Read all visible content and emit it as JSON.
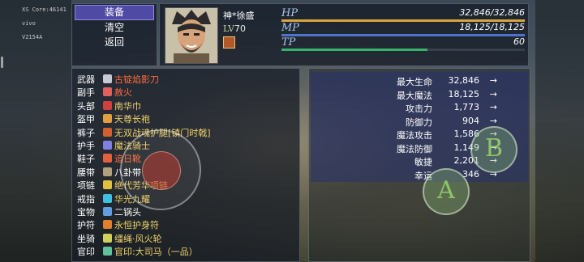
{
  "system": {
    "lines": [
      "XS Core:46141",
      "vivo",
      "V2154A"
    ]
  },
  "menu": {
    "items": [
      {
        "label": "装备",
        "active": true
      },
      {
        "label": "清空",
        "active": false
      },
      {
        "label": "返回",
        "active": false
      }
    ]
  },
  "character": {
    "name": "神*徐盛",
    "lv_prefix": "LV",
    "level": "70",
    "stats": [
      {
        "label": "HP",
        "value": "32,846/32,846",
        "fill": 1.0,
        "color": "#d9a43c"
      },
      {
        "label": "MP",
        "value": "18,125/18,125",
        "fill": 1.0,
        "color": "#4f73c9"
      },
      {
        "label": "TP",
        "value": "60",
        "fill": 0.6,
        "color": "#36b36a"
      }
    ]
  },
  "equipment": [
    {
      "slot": "武器",
      "item": "古锭焰影刀",
      "color": "#ff6b3d",
      "icon": "sword-icon",
      "icon_color": "#c9c9d6"
    },
    {
      "slot": "副手",
      "item": "赦火",
      "color": "#ff6b3d",
      "icon": "dagger-icon",
      "icon_color": "#e06060"
    },
    {
      "slot": "头部",
      "item": "南华巾",
      "color": "#f0d36a",
      "icon": "hat-icon",
      "icon_color": "#d04040"
    },
    {
      "slot": "盔甲",
      "item": "天尊长袍",
      "color": "#f0d36a",
      "icon": "armor-icon",
      "icon_color": "#e0a040"
    },
    {
      "slot": "裤子",
      "item": "无双战魂护腿[镇门时戟]",
      "color": "#f0d36a",
      "icon": "greaves-icon",
      "icon_color": "#d06030"
    },
    {
      "slot": "护手",
      "item": "魔法骑士",
      "color": "#f0d36a",
      "icon": "gauntlet-icon",
      "icon_color": "#8080e0"
    },
    {
      "slot": "鞋子",
      "item": "追日靴",
      "color": "#ff6b3d",
      "icon": "boots-icon",
      "icon_color": "#e06040"
    },
    {
      "slot": "腰带",
      "item": "八卦带",
      "color": "#ffffff",
      "icon": "belt-icon",
      "icon_color": "#b0a080"
    },
    {
      "slot": "项链",
      "item": "绝代芳华项链",
      "color": "#f0d36a",
      "icon": "necklace-icon",
      "icon_color": "#e0c040"
    },
    {
      "slot": "戒指",
      "item": "华光九耀",
      "color": "#f0d36a",
      "icon": "ring-icon",
      "icon_color": "#40c0e0"
    },
    {
      "slot": "宝物",
      "item": "二锅头",
      "color": "#ffffff",
      "icon": "bottle-icon",
      "icon_color": "#60a0e0"
    },
    {
      "slot": "护符",
      "item": "永恒护身符",
      "color": "#f0d36a",
      "icon": "amulet-icon",
      "icon_color": "#e08030"
    },
    {
      "slot": "坐骑",
      "item": "缰绳·风火轮",
      "color": "#f0d36a",
      "icon": "reins-icon",
      "icon_color": "#d0d060"
    },
    {
      "slot": "官印",
      "item": "官印:大司马（一品）",
      "color": "#f0d36a",
      "icon": "seal-icon",
      "icon_color": "#60c0a0"
    }
  ],
  "attributes": [
    {
      "label": "最大生命",
      "value": "32,846",
      "arrow": "→"
    },
    {
      "label": "最大魔法",
      "value": "18,125",
      "arrow": "→"
    },
    {
      "label": "攻击力",
      "value": "1,773",
      "arrow": "→"
    },
    {
      "label": "防御力",
      "value": "904",
      "arrow": "→"
    },
    {
      "label": "魔法攻击",
      "value": "1,586",
      "arrow": "→"
    },
    {
      "label": "魔法防御",
      "value": "1,149",
      "arrow": "→"
    },
    {
      "label": "敏捷",
      "value": "2,201",
      "arrow": "→"
    },
    {
      "label": "幸运",
      "value": "346",
      "arrow": "→"
    }
  ],
  "controls": {
    "a_label": "A",
    "b_label": "B"
  }
}
